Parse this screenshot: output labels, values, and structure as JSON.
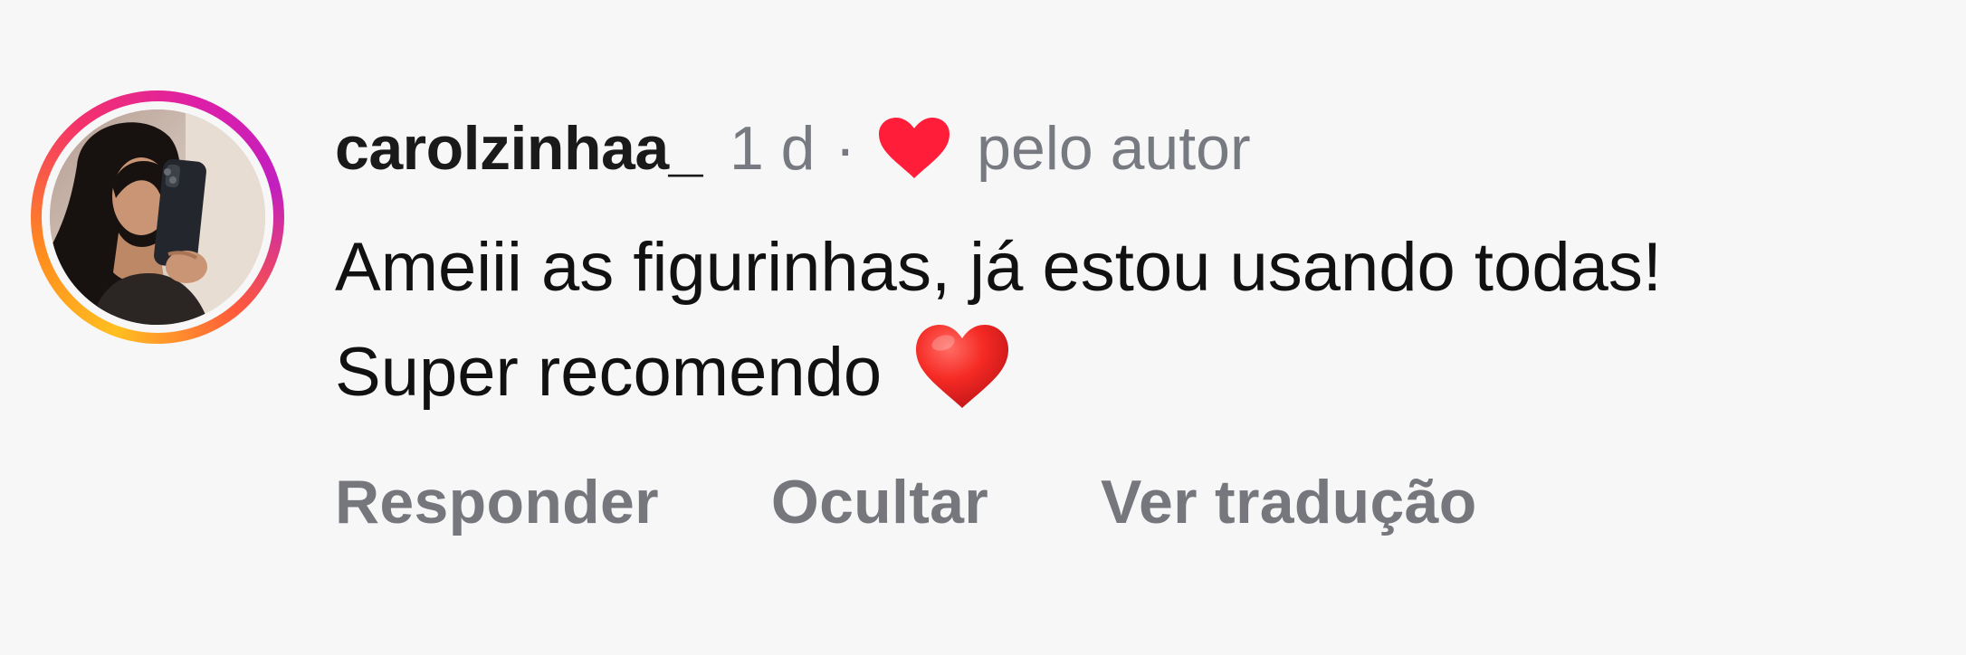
{
  "comment": {
    "username": "carolzinhaa_",
    "timestamp": "1 d",
    "separator": "·",
    "liked_by": "pelo autor",
    "text": "Ameiii as figurinhas, já estou usando todas! Super recomendo",
    "emoji": "❤️",
    "like_icon": "heart-icon",
    "avatar": "profile-photo",
    "colors": {
      "username": "#1a1a1a",
      "meta": "#777a80",
      "body": "#111111",
      "action": "#75777d",
      "heart": "#ff1d3a",
      "story_ring_start": "#ffbf1f",
      "story_ring_end": "#c21fc0"
    }
  },
  "actions": {
    "reply": "Responder",
    "hide": "Ocultar",
    "translate": "Ver tradução"
  }
}
